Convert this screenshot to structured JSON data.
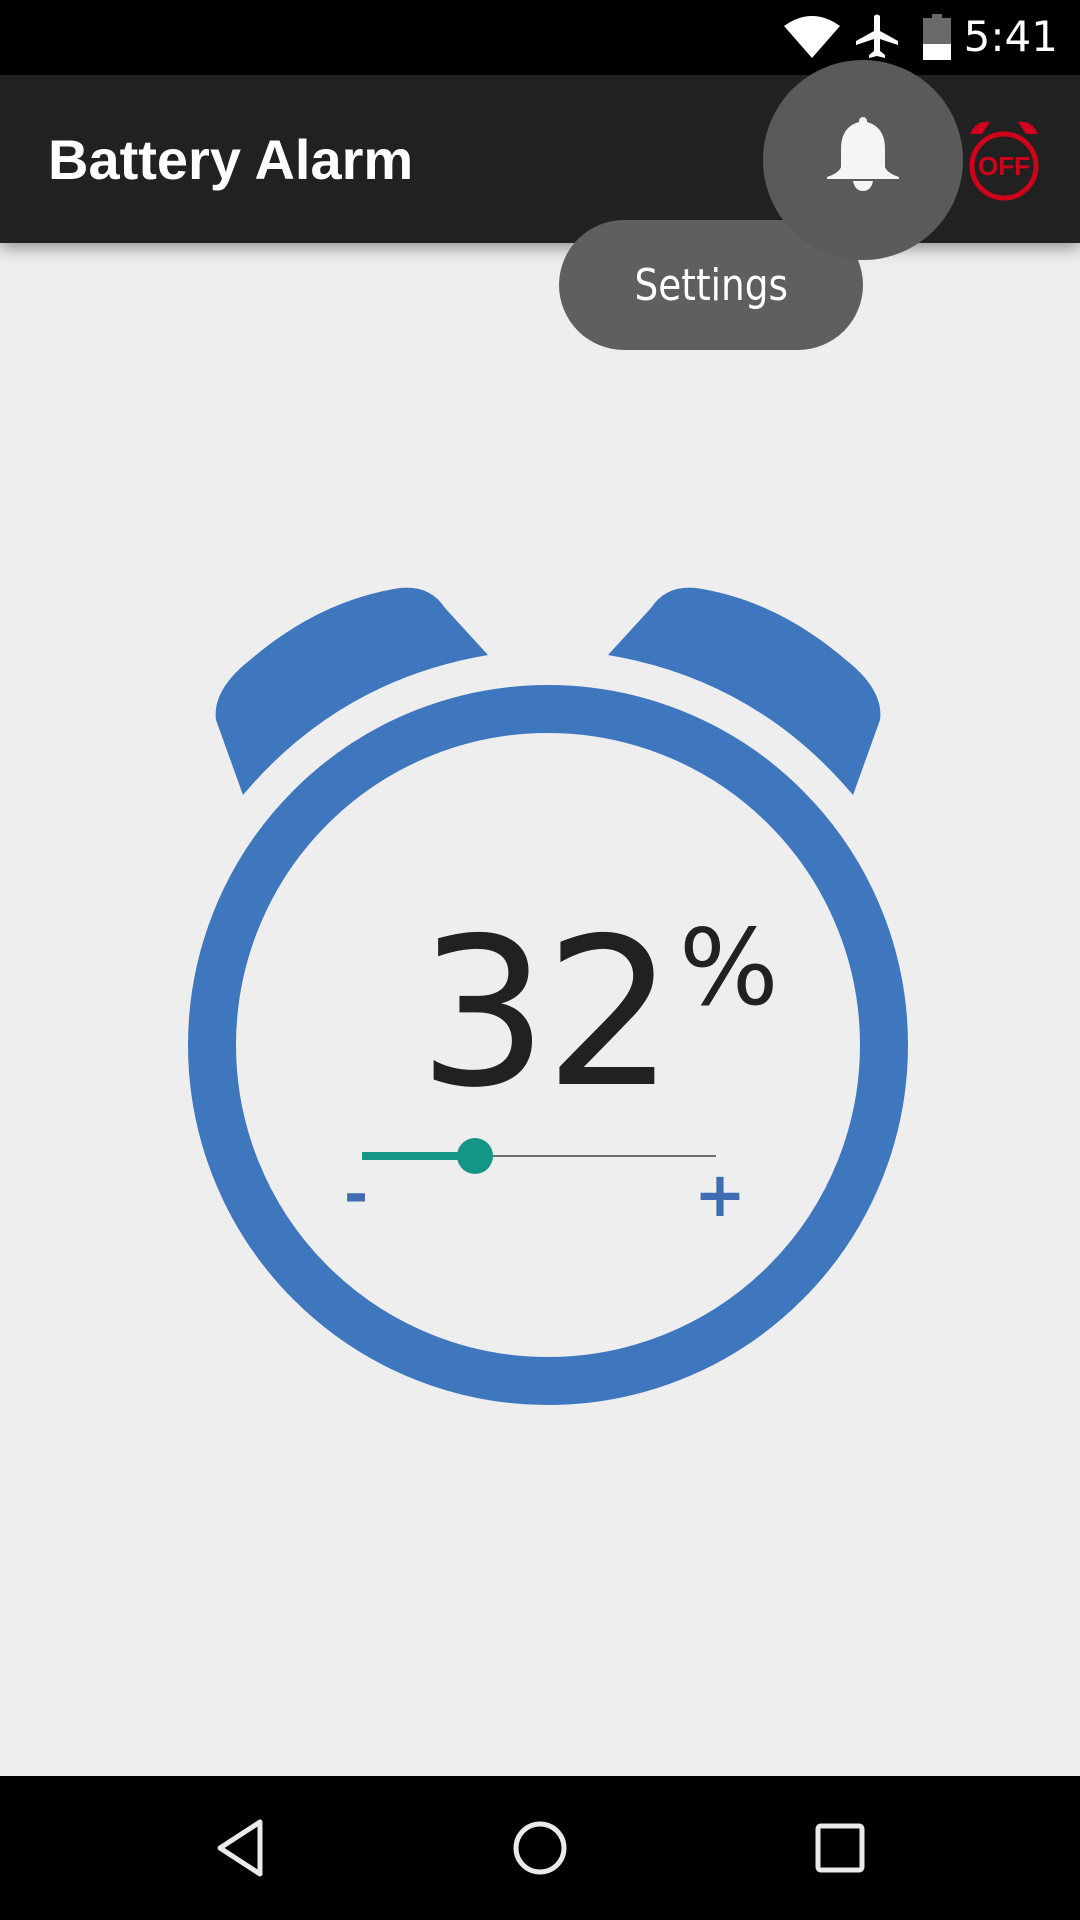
{
  "status_bar": {
    "time": "5:41",
    "icons": [
      "wifi-icon",
      "airplane-mode-icon",
      "battery-icon"
    ],
    "battery_level_percent": 32
  },
  "app_bar": {
    "title": "Battery Alarm",
    "actions": [
      {
        "name": "settings-bell",
        "icon": "bell-icon",
        "tooltip": "Settings",
        "highlighted": true
      },
      {
        "name": "alarm-toggle",
        "icon": "alarm-clock-icon",
        "label": "OFF",
        "color": "#d0021b"
      }
    ]
  },
  "tooltip": {
    "label": "Settings"
  },
  "alarm": {
    "percent_value": "32",
    "percent_symbol": "%",
    "slider": {
      "value_percent": 32,
      "min_fraction": 0,
      "max_fraction": 1,
      "fill_fraction": 0.32
    },
    "minus_label": "-",
    "plus_label": "+",
    "accent_color": "#149686",
    "clock_color": "#3f77bf"
  },
  "nav_bar": {
    "buttons": [
      "back-icon",
      "home-icon",
      "recents-icon"
    ]
  }
}
